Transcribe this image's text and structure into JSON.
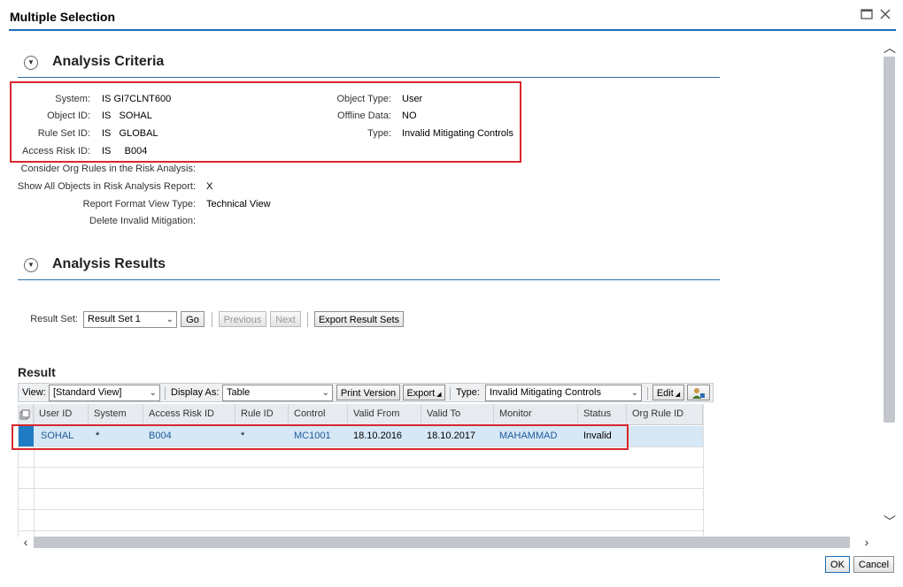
{
  "window": {
    "title": "Multiple Selection",
    "maximize_icon": "maximize-icon",
    "close_icon": "close-icon"
  },
  "criteria": {
    "title": "Analysis Criteria",
    "rows_left": [
      {
        "label": "System:",
        "value": "IS  GI7CLNT600"
      },
      {
        "label": "Object ID:",
        "value": "IS   SOHAL"
      },
      {
        "label": "Rule Set ID:",
        "value": "IS   GLOBAL"
      },
      {
        "label": "Access Risk ID:",
        "value": "IS     B004"
      }
    ],
    "rows_right": [
      {
        "label": "Object Type:",
        "value": "User"
      },
      {
        "label": "Offline Data:",
        "value": "NO"
      },
      {
        "label": "Type:",
        "value": "Invalid Mitigating Controls"
      }
    ],
    "extra": [
      {
        "label": "Consider Org Rules in the Risk Analysis:",
        "value": ""
      },
      {
        "label": "Show All Objects in Risk Analysis Report:",
        "value": "X"
      },
      {
        "label": "Report Format View Type:",
        "value": "Technical View"
      },
      {
        "label": "Delete Invalid Mitigation:",
        "value": ""
      }
    ]
  },
  "results": {
    "title": "Analysis Results",
    "result_set_label": "Result Set:",
    "result_set_value": "Result Set 1",
    "go": "Go",
    "previous": "Previous",
    "next": "Next",
    "export_sets": "Export Result Sets"
  },
  "result": {
    "title": "Result",
    "toolbar": {
      "view_label": "View:",
      "view_value": "[Standard View]",
      "display_label": "Display As:",
      "display_value": "Table",
      "print": "Print Version",
      "export": "Export",
      "type_label": "Type:",
      "type_value": "Invalid Mitigating Controls",
      "edit": "Edit"
    },
    "columns": [
      "User ID",
      "System",
      "Access Risk ID",
      "Rule ID",
      "Control",
      "Valid From",
      "Valid To",
      "Monitor",
      "Status",
      "Org Rule ID"
    ],
    "row": [
      "SOHAL",
      "*",
      "B004",
      "*",
      "MC1001",
      "18.10.2016",
      "18.10.2017",
      "MAHAMMAD",
      "Invalid",
      ""
    ]
  },
  "footer": {
    "ok": "OK",
    "cancel": "Cancel"
  },
  "colors": {
    "accent": "#1f6db5",
    "highlight": "#d9272e",
    "selected_row": "#d6e7f5"
  }
}
